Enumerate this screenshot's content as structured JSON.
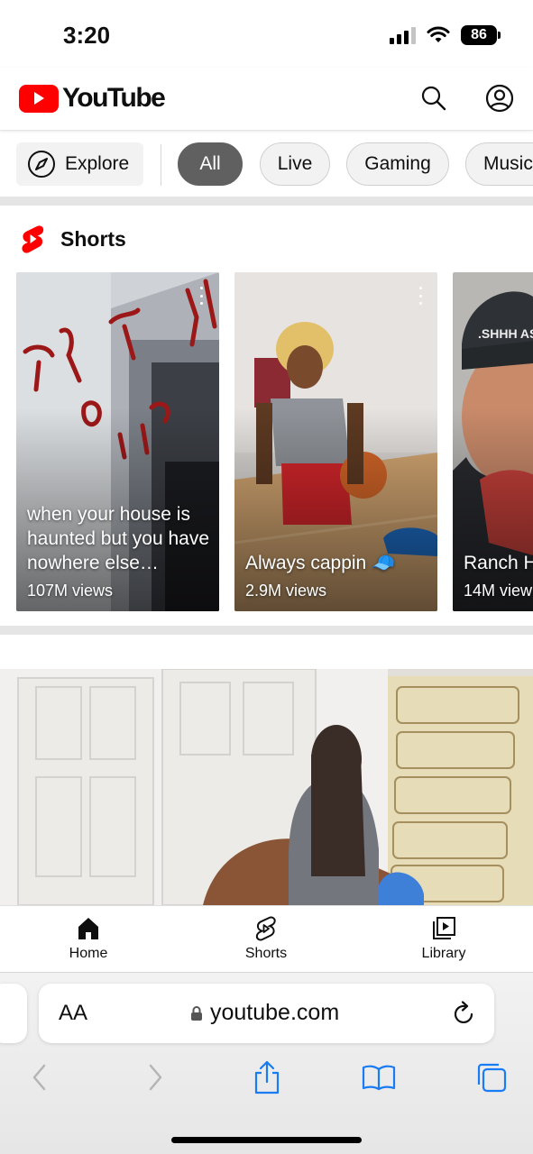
{
  "status_bar": {
    "time": "3:20",
    "battery": "86"
  },
  "header": {
    "logo_text": "YouTube",
    "icons": [
      "search-icon",
      "account-icon"
    ]
  },
  "chips": [
    {
      "label": "Explore",
      "icon": "compass-icon"
    },
    {
      "label": "All",
      "selected": true
    },
    {
      "label": "Live"
    },
    {
      "label": "Gaming"
    },
    {
      "label": "Music"
    }
  ],
  "shorts": {
    "title": "Shorts",
    "items": [
      {
        "title": "when your house is haunted but you have nowhere else…",
        "views": "107M views"
      },
      {
        "title": "Always cappin 🧢",
        "views": "2.9M views"
      },
      {
        "title": "Ranch H",
        "views": "14M view",
        "hat_text": ".SHHH AS"
      }
    ]
  },
  "bottom_nav": {
    "items": [
      {
        "label": "Home",
        "icon": "home-icon"
      },
      {
        "label": "Shorts",
        "icon": "shorts-icon"
      },
      {
        "label": "Library",
        "icon": "library-icon"
      }
    ]
  },
  "browser": {
    "text_size_label": "AA",
    "url": "youtube.com",
    "toolbar_icons": [
      "back-icon",
      "forward-icon",
      "share-icon",
      "bookmarks-icon",
      "tabs-icon"
    ]
  },
  "colors": {
    "brand_red": "#ff0000",
    "active_chip": "#606060",
    "safari_blue": "#1a7cf4"
  }
}
